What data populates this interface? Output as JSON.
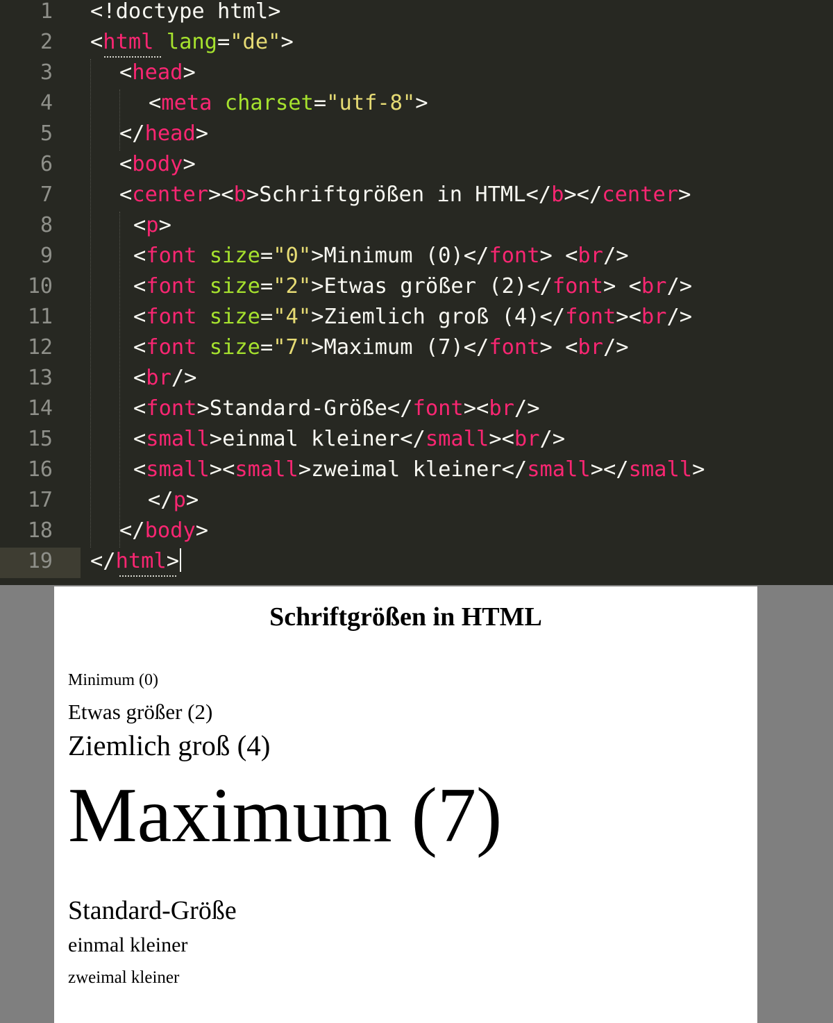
{
  "editor": {
    "current_line": 19,
    "lines": [
      {
        "n": "1",
        "tokens": [
          [
            "p",
            "<!doctype html>"
          ]
        ]
      },
      {
        "n": "2",
        "tokens": [
          [
            "p",
            "<"
          ],
          [
            "tag",
            "html"
          ],
          [
            "p",
            " "
          ],
          [
            "attr",
            "lang"
          ],
          [
            "p",
            "="
          ],
          [
            "str",
            "\"de\""
          ],
          [
            "p",
            ">"
          ]
        ]
      },
      {
        "n": "3",
        "tokens": [
          [
            "p",
            "<"
          ],
          [
            "tag",
            "head"
          ],
          [
            "p",
            ">"
          ]
        ]
      },
      {
        "n": "4",
        "tokens": [
          [
            "p",
            "<"
          ],
          [
            "tag",
            "meta"
          ],
          [
            "p",
            " "
          ],
          [
            "attr",
            "charset"
          ],
          [
            "p",
            "="
          ],
          [
            "str",
            "\"utf-8\""
          ],
          [
            "p",
            ">"
          ]
        ]
      },
      {
        "n": "5",
        "tokens": [
          [
            "p",
            "</"
          ],
          [
            "tag",
            "head"
          ],
          [
            "p",
            ">"
          ]
        ]
      },
      {
        "n": "6",
        "tokens": [
          [
            "p",
            "<"
          ],
          [
            "tag",
            "body"
          ],
          [
            "p",
            ">"
          ]
        ]
      },
      {
        "n": "7",
        "tokens": [
          [
            "p",
            "<"
          ],
          [
            "tag",
            "center"
          ],
          [
            "p",
            "><"
          ],
          [
            "tag",
            "b"
          ],
          [
            "p",
            ">Schriftgrößen in HTML</"
          ],
          [
            "tag",
            "b"
          ],
          [
            "p",
            "></"
          ],
          [
            "tag",
            "center"
          ],
          [
            "p",
            ">"
          ]
        ]
      },
      {
        "n": "8",
        "tokens": [
          [
            "p",
            "<"
          ],
          [
            "tag",
            "p"
          ],
          [
            "p",
            ">"
          ]
        ]
      },
      {
        "n": "9",
        "tokens": [
          [
            "p",
            "<"
          ],
          [
            "tag",
            "font"
          ],
          [
            "p",
            " "
          ],
          [
            "attr",
            "size"
          ],
          [
            "p",
            "="
          ],
          [
            "str",
            "\"0\""
          ],
          [
            "p",
            ">Minimum (0)</"
          ],
          [
            "tag",
            "font"
          ],
          [
            "p",
            "> <"
          ],
          [
            "tag",
            "br"
          ],
          [
            "p",
            "/>"
          ]
        ]
      },
      {
        "n": "10",
        "tokens": [
          [
            "p",
            "<"
          ],
          [
            "tag",
            "font"
          ],
          [
            "p",
            " "
          ],
          [
            "attr",
            "size"
          ],
          [
            "p",
            "="
          ],
          [
            "str",
            "\"2\""
          ],
          [
            "p",
            ">Etwas größer (2)</"
          ],
          [
            "tag",
            "font"
          ],
          [
            "p",
            "> <"
          ],
          [
            "tag",
            "br"
          ],
          [
            "p",
            "/>"
          ]
        ]
      },
      {
        "n": "11",
        "tokens": [
          [
            "p",
            "<"
          ],
          [
            "tag",
            "font"
          ],
          [
            "p",
            " "
          ],
          [
            "attr",
            "size"
          ],
          [
            "p",
            "="
          ],
          [
            "str",
            "\"4\""
          ],
          [
            "p",
            ">Ziemlich groß (4)</"
          ],
          [
            "tag",
            "font"
          ],
          [
            "p",
            "><"
          ],
          [
            "tag",
            "br"
          ],
          [
            "p",
            "/>"
          ]
        ]
      },
      {
        "n": "12",
        "tokens": [
          [
            "p",
            "<"
          ],
          [
            "tag",
            "font"
          ],
          [
            "p",
            " "
          ],
          [
            "attr",
            "size"
          ],
          [
            "p",
            "="
          ],
          [
            "str",
            "\"7\""
          ],
          [
            "p",
            ">Maximum (7)</"
          ],
          [
            "tag",
            "font"
          ],
          [
            "p",
            "> <"
          ],
          [
            "tag",
            "br"
          ],
          [
            "p",
            "/>"
          ]
        ]
      },
      {
        "n": "13",
        "tokens": [
          [
            "p",
            "<"
          ],
          [
            "tag",
            "br"
          ],
          [
            "p",
            "/>"
          ]
        ]
      },
      {
        "n": "14",
        "tokens": [
          [
            "p",
            "<"
          ],
          [
            "tag",
            "font"
          ],
          [
            "p",
            ">Standard-Größe</"
          ],
          [
            "tag",
            "font"
          ],
          [
            "p",
            "><"
          ],
          [
            "tag",
            "br"
          ],
          [
            "p",
            "/>"
          ]
        ]
      },
      {
        "n": "15",
        "tokens": [
          [
            "p",
            "<"
          ],
          [
            "tag",
            "small"
          ],
          [
            "p",
            ">einmal kleiner</"
          ],
          [
            "tag",
            "small"
          ],
          [
            "p",
            "><"
          ],
          [
            "tag",
            "br"
          ],
          [
            "p",
            "/>"
          ]
        ]
      },
      {
        "n": "16",
        "tokens": [
          [
            "p",
            "<"
          ],
          [
            "tag",
            "small"
          ],
          [
            "p",
            "><"
          ],
          [
            "tag",
            "small"
          ],
          [
            "p",
            ">zweimal kleiner</"
          ],
          [
            "tag",
            "small"
          ],
          [
            "p",
            "></"
          ],
          [
            "tag",
            "small"
          ],
          [
            "p",
            ">"
          ]
        ]
      },
      {
        "n": "17",
        "tokens": [
          [
            "p",
            "</"
          ],
          [
            "tag",
            "p"
          ],
          [
            "p",
            ">"
          ]
        ]
      },
      {
        "n": "18",
        "tokens": [
          [
            "p",
            "</"
          ],
          [
            "tag",
            "body"
          ],
          [
            "p",
            ">"
          ]
        ]
      },
      {
        "n": "19",
        "tokens": [
          [
            "p",
            "</"
          ],
          [
            "tag",
            "html"
          ],
          [
            "p",
            ">"
          ]
        ]
      }
    ]
  },
  "preview": {
    "heading": "Schriftgrößen in HTML",
    "minimum": "Minimum (0)",
    "etwas_groesser": "Etwas größer (2)",
    "ziemlich_gross": "Ziemlich groß (4)",
    "maximum": "Maximum (7)",
    "standard": "Standard-Größe",
    "einmal_kleiner": "einmal kleiner",
    "zweimal_kleiner": "zweimal kleiner"
  }
}
